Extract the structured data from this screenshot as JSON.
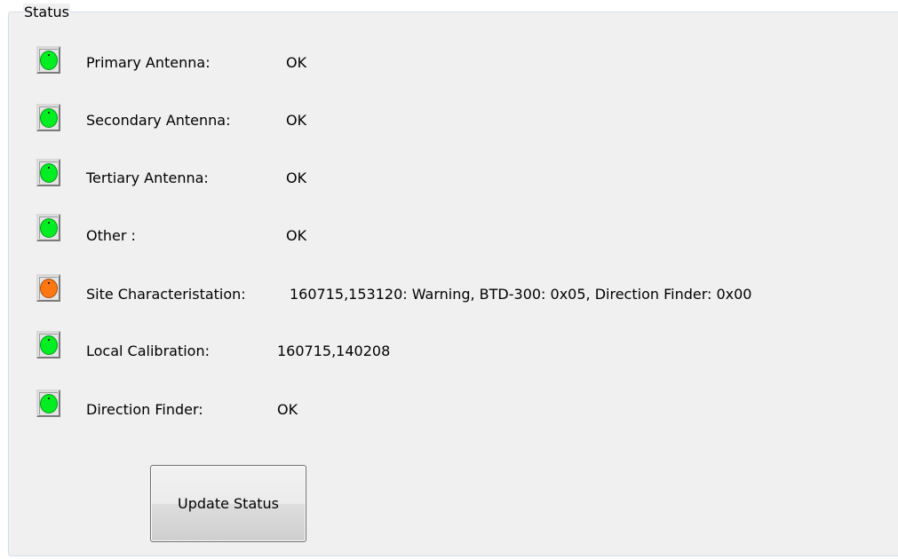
{
  "group": {
    "title": "Status"
  },
  "colors": {
    "ok": "#00ee22",
    "warning": "#ff7711"
  },
  "rows": [
    {
      "label": "Primary Antenna:",
      "value": "OK",
      "state": "ok"
    },
    {
      "label": "Secondary Antenna:",
      "value": "OK",
      "state": "ok"
    },
    {
      "label": "Tertiary Antenna:",
      "value": "OK",
      "state": "ok"
    },
    {
      "label": "Other :",
      "value": "OK",
      "state": "ok"
    },
    {
      "label": "Site Characteristation:",
      "value": "160715,153120: Warning, BTD-300: 0x05, Direction Finder: 0x00",
      "state": "warning"
    },
    {
      "label": "Local Calibration:",
      "value": "160715,140208",
      "state": "ok"
    },
    {
      "label": "Direction Finder:",
      "value": "OK",
      "state": "ok"
    }
  ],
  "update_button": {
    "label": "Update Status"
  }
}
